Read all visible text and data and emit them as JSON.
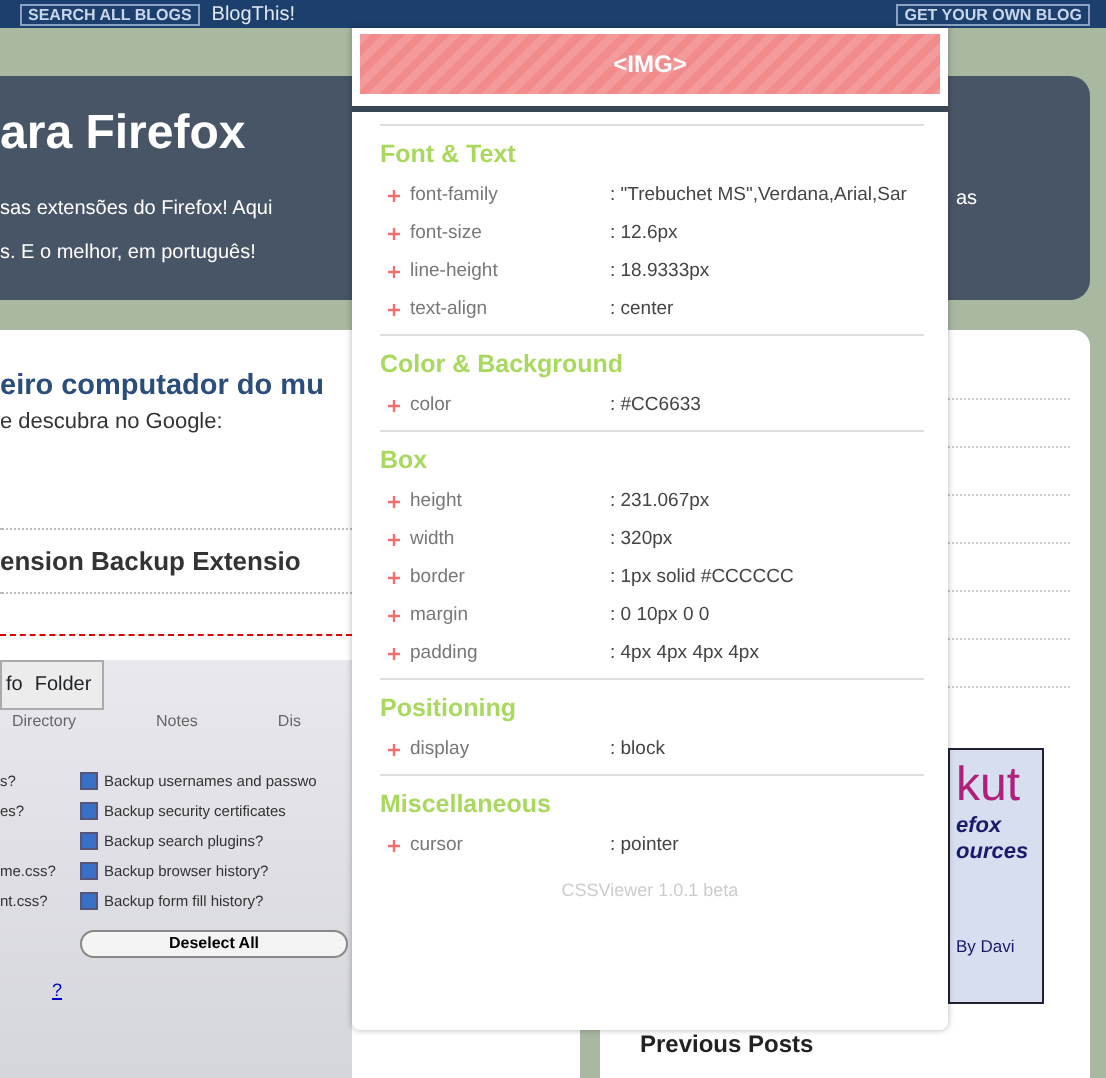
{
  "top_bar": {
    "left_button": "SEARCH ALL BLOGS",
    "link": "BlogThis!",
    "right_button": "GET YOUR OWN BLOG"
  },
  "header": {
    "title": "ara Firefox",
    "description": [
      "sas extensões do Firefox! Aqui",
      "s. E o melhor, em português!"
    ],
    "description_fragment": "as"
  },
  "post": {
    "title": "eiro computador do mu",
    "text": "e descubra no Google:",
    "heading": "ension Backup Extensio",
    "screenshot": {
      "toolbar": [
        "fo",
        "Folder"
      ],
      "tabs": [
        "Directory",
        "Notes",
        "Dis"
      ],
      "options": [
        {
          "left": "s?",
          "label": "Backup usernames and passwo",
          "checked": true
        },
        {
          "left": "es?",
          "label": "Backup security certificates",
          "checked": true
        },
        {
          "label": "Backup search plugins?",
          "checked": true
        },
        {
          "left": "me.css?",
          "label": "Backup browser history?",
          "checked": true
        },
        {
          "left": "nt.css?",
          "label": "Backup form fill history?",
          "checked": true
        }
      ],
      "button": "Deselect All",
      "help": "?"
    }
  },
  "sidebar": {
    "ad": [
      "kut",
      "efox",
      "ources",
      "By Davi"
    ],
    "heading": "Previous Posts"
  },
  "css_viewer": {
    "title": "<IMG>",
    "sections": [
      {
        "title": "Font & Text",
        "properties": [
          {
            "name": "font-family",
            "value": ": \"Trebuchet MS\",Verdana,Arial,Sar"
          },
          {
            "name": "font-size",
            "value": ": 12.6px"
          },
          {
            "name": "line-height",
            "value": ": 18.9333px"
          },
          {
            "name": "text-align",
            "value": ": center"
          }
        ]
      },
      {
        "title": "Color & Background",
        "properties": [
          {
            "name": "color",
            "value": ": #CC6633"
          }
        ]
      },
      {
        "title": "Box",
        "properties": [
          {
            "name": "height",
            "value": ": 231.067px"
          },
          {
            "name": "width",
            "value": ": 320px"
          },
          {
            "name": "border",
            "value": ": 1px solid #CCCCCC"
          },
          {
            "name": "margin",
            "value": ": 0 10px 0 0"
          },
          {
            "name": "padding",
            "value": ": 4px 4px 4px 4px"
          }
        ]
      },
      {
        "title": "Positioning",
        "properties": [
          {
            "name": "display",
            "value": ": block"
          }
        ]
      },
      {
        "title": "Miscellaneous",
        "properties": [
          {
            "name": "cursor",
            "value": ": pointer"
          }
        ]
      }
    ],
    "footer": "CSSViewer 1.0.1 beta"
  }
}
